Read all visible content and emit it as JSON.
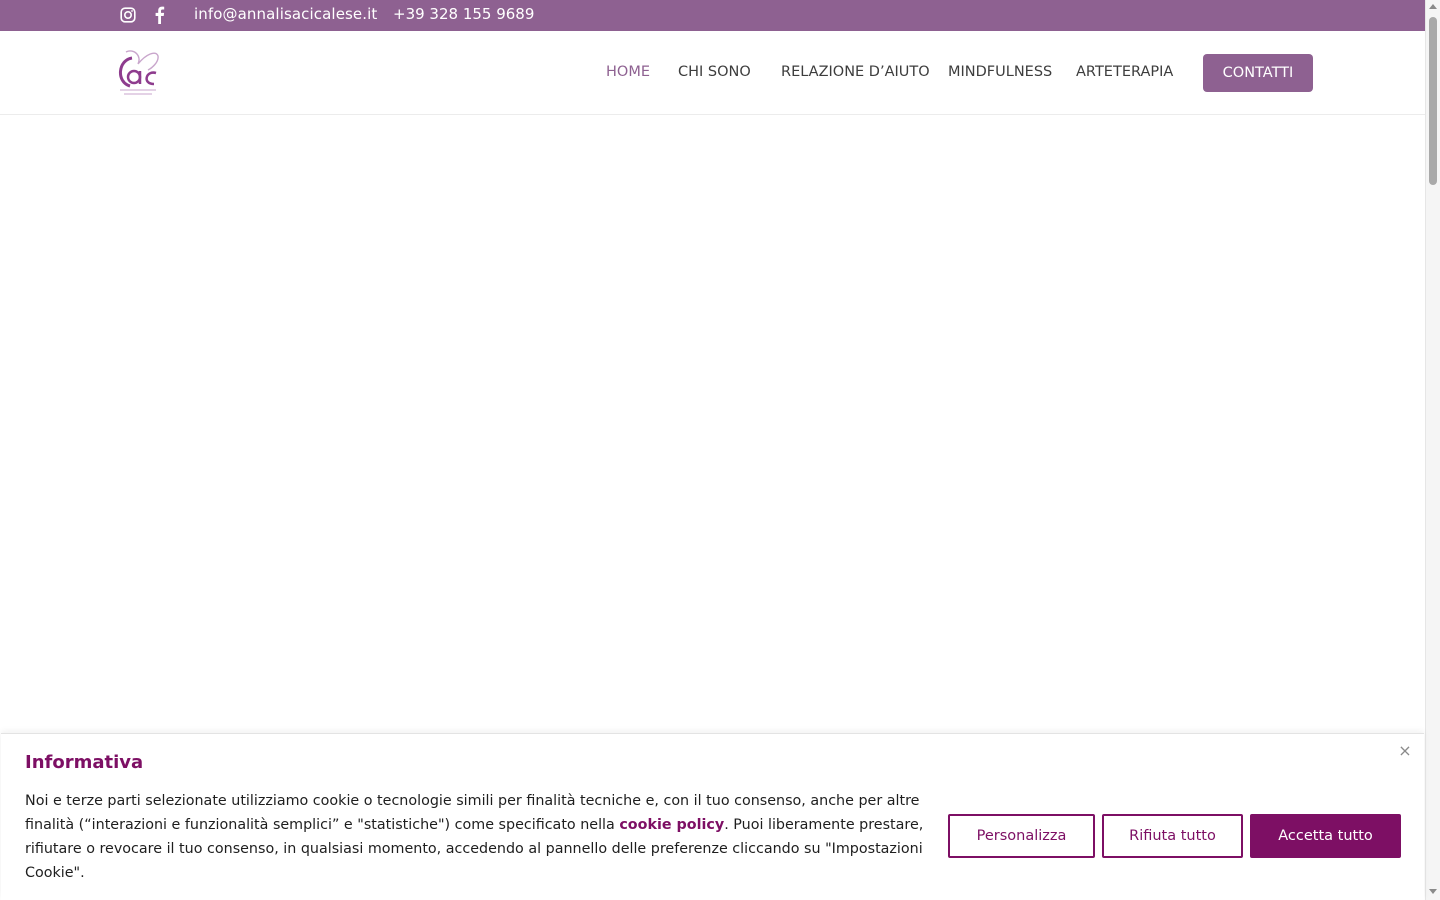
{
  "topbar": {
    "email": "info@annalisacicalese.it",
    "phone": "+39 328 155 9689",
    "icons": [
      "instagram-icon",
      "facebook-icon"
    ]
  },
  "header": {
    "logo_text": "ac",
    "nav": {
      "home": "HOME",
      "chi_sono": "CHI SONO",
      "relazione": "RELAZIONE D’AIUTO",
      "mindfulness": "MINDFULNESS",
      "arteterapia": "ARTETERAPIA"
    },
    "contact_button": "CONTATTI"
  },
  "cookie": {
    "title": "Informativa",
    "text_before_link": "Noi e terze parti selezionate utilizziamo cookie o tecnologie simili per finalità tecniche e, con il tuo consenso, anche per altre finalità (“interazioni e funzionalità semplici” e \"statistiche\") come specificato nella ",
    "link": "cookie policy",
    "text_after_link": ". Puoi liberamente prestare, rifiutare o revocare il tuo consenso, in qualsiasi momento, accedendo al pannello delle preferenze cliccando su \"Impostazioni Cookie\".",
    "buttons": {
      "personalize": "Personalizza",
      "reject": "Rifiuta tutto",
      "accept": "Accetta tutto"
    },
    "close_symbol": "×"
  },
  "colors": {
    "brand_purple": "#8e6191",
    "cookie_accent": "#7d0f64"
  }
}
